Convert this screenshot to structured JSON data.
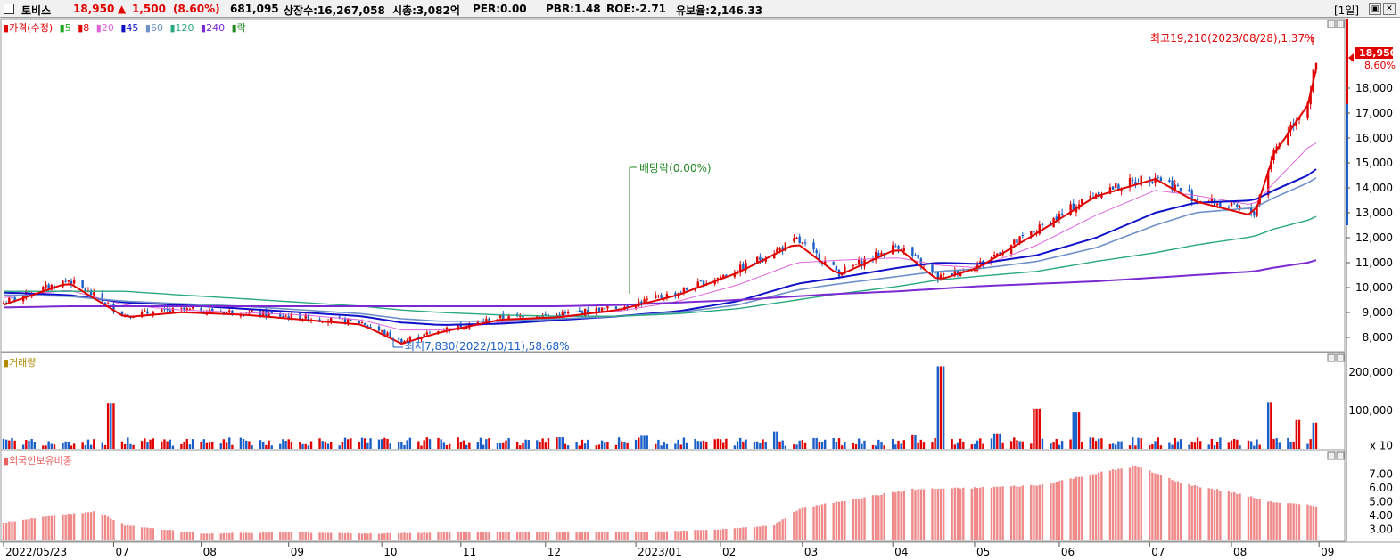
{
  "header": {
    "name": "토비스",
    "price": "18,950",
    "change_arrow": "▲",
    "change": "1,500",
    "change_pct": "(8.60%)",
    "volume": "681,095",
    "listed_shares": "상장수:16,267,058",
    "market_cap": "시총:3,082억",
    "per": "PER:0.00",
    "pbr": "PBR:1.48",
    "roe": "ROE:-2.71",
    "float_rate": "유보율:2,146.33",
    "period_button": "[1일]"
  },
  "legend": {
    "price": "가격(수정)",
    "ma": [
      "5",
      "8",
      "20",
      "45",
      "60",
      "120",
      "240",
      "락"
    ],
    "ma_colors": [
      "#22a722",
      "#e00000",
      "#dd66dd",
      "#1010c8",
      "#6e90c8",
      "#2aa880",
      "#7a2ad0",
      "#228822"
    ],
    "volume": "거래량",
    "foreign": "외국인보유비중"
  },
  "annotations": {
    "high": "최고19,210(2023/08/28),1.37%",
    "low": "최저7,830(2022/10/11),58.68%",
    "dividend": "배당락(0.00%)",
    "last_price": "18,950",
    "last_pct": "8.60%"
  },
  "colors": {
    "up": "#e00000",
    "down": "#1a5fc8",
    "ma5": "#22a722",
    "ma20": "#dd66dd",
    "ma45": "#1010c8",
    "ma60": "#6e90c8",
    "ma120": "#2aa880",
    "ma240": "#7a2ad0",
    "foreign": "#f08a8a"
  },
  "chart_data": [
    {
      "type": "line",
      "title": "가격(수정)",
      "x": [
        "2022-05-23",
        "2022-06-15",
        "2022-07-05",
        "2022-07-25",
        "2022-08-16",
        "2022-09-06",
        "2022-09-27",
        "2022-10-11",
        "2022-10-25",
        "2022-11-15",
        "2022-12-06",
        "2022-12-27",
        "2023-01-17",
        "2023-02-07",
        "2023-02-28",
        "2023-03-15",
        "2023-04-05",
        "2023-04-19",
        "2023-05-03",
        "2023-05-24",
        "2023-06-14",
        "2023-07-05",
        "2023-07-19",
        "2023-08-09",
        "2023-08-16",
        "2023-08-28",
        "2023-08-31"
      ],
      "series": [
        {
          "name": "가격(수정)",
          "values": [
            9400,
            10300,
            8900,
            9100,
            9000,
            8800,
            8600,
            7830,
            8300,
            8800,
            8900,
            9200,
            9800,
            10700,
            11900,
            10600,
            11700,
            10400,
            10900,
            12300,
            13800,
            14500,
            13600,
            13000,
            15500,
            17500,
            18950
          ]
        },
        {
          "name": "20",
          "values": [
            9600,
            9900,
            9300,
            9100,
            9000,
            8900,
            8700,
            8300,
            8300,
            8600,
            8850,
            9050,
            9450,
            10100,
            11000,
            11100,
            11200,
            10900,
            10800,
            11700,
            12900,
            13900,
            13700,
            13300,
            14200,
            15600,
            15800
          ]
        },
        {
          "name": "45",
          "values": [
            9800,
            9700,
            9400,
            9300,
            9150,
            9000,
            8850,
            8600,
            8500,
            8550,
            8700,
            8850,
            9050,
            9450,
            10150,
            10400,
            10800,
            11000,
            10950,
            11300,
            12000,
            13000,
            13400,
            13500,
            13900,
            14500,
            14750
          ]
        },
        {
          "name": "60",
          "values": [
            9700,
            9650,
            9450,
            9350,
            9250,
            9100,
            8950,
            8750,
            8650,
            8650,
            8750,
            8850,
            9000,
            9300,
            9900,
            10150,
            10450,
            10650,
            10750,
            11050,
            11600,
            12500,
            13000,
            13200,
            13600,
            14200,
            14400
          ]
        },
        {
          "name": "120",
          "values": [
            9850,
            9850,
            9850,
            9700,
            9550,
            9400,
            9250,
            9100,
            9000,
            8900,
            8850,
            8850,
            8950,
            9150,
            9500,
            9750,
            10050,
            10300,
            10450,
            10650,
            11050,
            11400,
            11700,
            12050,
            12350,
            12700,
            12850
          ]
        },
        {
          "name": "240",
          "values": [
            9200,
            9250,
            9250,
            9250,
            9250,
            9250,
            9250,
            9250,
            9250,
            9250,
            9250,
            9300,
            9400,
            9500,
            9650,
            9750,
            9850,
            9950,
            10050,
            10150,
            10250,
            10400,
            10500,
            10650,
            10800,
            11000,
            11100
          ]
        }
      ],
      "ylim": [
        7500,
        20500
      ],
      "y_ticks": [
        "8,000",
        "9,000",
        "10,000",
        "11,000",
        "12,000",
        "13,000",
        "14,000",
        "15,000",
        "16,000",
        "17,000",
        "18,000"
      ]
    },
    {
      "type": "bar",
      "title": "거래량",
      "x": [
        "2022-05-23",
        "2022-06-30",
        "2022-07-15",
        "2022-09-06",
        "2022-10-20",
        "2022-11-15",
        "2022-12-06",
        "2023-01-05",
        "2023-02-20",
        "2023-03-06",
        "2023-04-10",
        "2023-04-20",
        "2023-05-10",
        "2023-05-24",
        "2023-06-07",
        "2023-08-14",
        "2023-08-25",
        "2023-08-31"
      ],
      "values": [
        15000,
        118000,
        20000,
        12000,
        18000,
        14000,
        30000,
        34000,
        45000,
        28000,
        35000,
        215000,
        40000,
        105000,
        95000,
        120000,
        75000,
        68000
      ],
      "y_ticks": [
        "200,000",
        "100,000",
        "x 10"
      ],
      "ylim": [
        0,
        230000
      ]
    },
    {
      "type": "bar",
      "title": "외국인보유비중",
      "x": [
        "2022-05-23",
        "2022-06-10",
        "2022-06-25",
        "2022-07-05",
        "2022-08-01",
        "2022-09-01",
        "2022-10-01",
        "2022-11-01",
        "2022-12-01",
        "2023-01-02",
        "2023-02-01",
        "2023-02-20",
        "2023-03-01",
        "2023-03-20",
        "2023-04-10",
        "2023-05-01",
        "2023-05-25",
        "2023-06-15",
        "2023-06-28",
        "2023-07-15",
        "2023-08-01",
        "2023-08-15",
        "2023-08-31"
      ],
      "values": [
        3.5,
        4.0,
        4.3,
        3.3,
        2.7,
        2.8,
        2.7,
        2.8,
        2.8,
        2.8,
        3.0,
        3.3,
        4.5,
        5.2,
        5.9,
        6.0,
        6.2,
        7.1,
        7.6,
        6.3,
        5.7,
        5.0,
        4.7
      ],
      "y_ticks": [
        "7.00",
        "6.00",
        "5.00",
        "4.00",
        "3.00"
      ],
      "ylim": [
        2.2,
        8.2
      ]
    }
  ],
  "x_axis_labels": [
    "2022/05/23",
    "07",
    "08",
    "09",
    "10",
    "11",
    "12",
    "2023/01",
    "02",
    "03",
    "04",
    "05",
    "06",
    "07",
    "08",
    "09"
  ]
}
